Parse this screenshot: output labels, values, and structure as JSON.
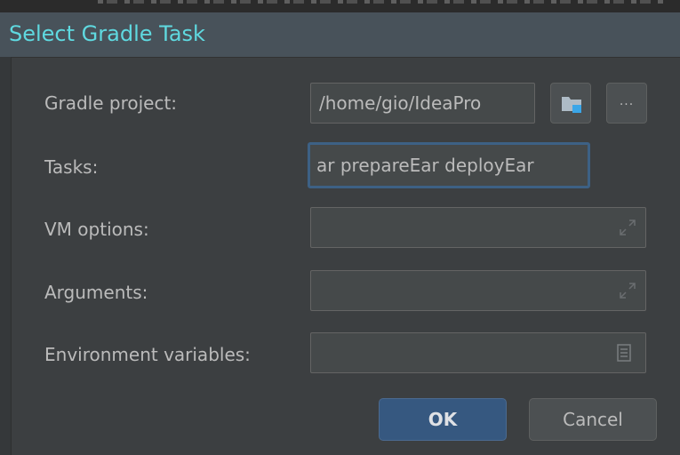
{
  "dialog": {
    "title": "Select Gradle Task"
  },
  "form": {
    "gradle_project": {
      "label": "Gradle project:",
      "value": "/home/gio/IdeaPro",
      "browse_icon": "folder-icon",
      "more_label": "..."
    },
    "tasks": {
      "label": "Tasks:",
      "value": "ar prepareEar deployEar"
    },
    "vm_options": {
      "label": "VM options:",
      "value": "",
      "expand_icon": "expand-icon"
    },
    "arguments": {
      "label": "Arguments:",
      "value": "",
      "expand_icon": "expand-icon"
    },
    "environment_variables": {
      "label": "Environment variables:",
      "value": "",
      "edit_icon": "document-icon"
    }
  },
  "buttons": {
    "ok_label": "OK",
    "cancel_label": "Cancel"
  },
  "colors": {
    "title": "#5fd9e0",
    "background": "#3c3f41",
    "focus_border": "#3d6185",
    "ok_button": "#365880"
  }
}
